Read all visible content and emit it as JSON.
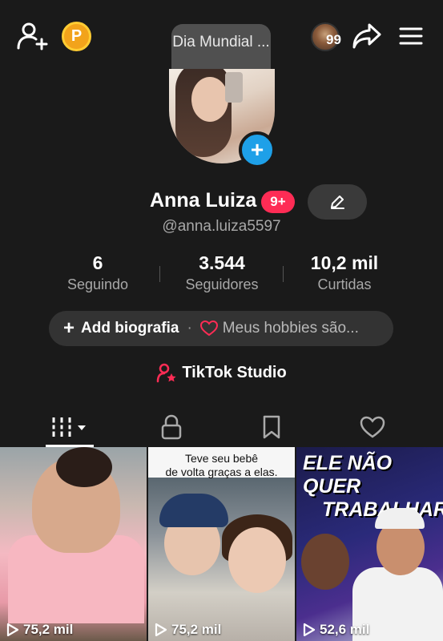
{
  "topbar": {
    "note_text": "Dia Mundial ...",
    "visitor_count": "99",
    "coin_letter": "P"
  },
  "profile": {
    "name": "Anna Luiza",
    "badge": "9+",
    "handle": "@anna.luiza5597"
  },
  "stats": [
    {
      "value": "6",
      "label": "Seguindo"
    },
    {
      "value": "3.544",
      "label": "Seguidores"
    },
    {
      "value": "10,2 mil",
      "label": "Curtidas"
    }
  ],
  "bio": {
    "add_label": "Add biografia",
    "hobbies_label": "Meus hobbies são..."
  },
  "studio": {
    "label": "TikTok Studio"
  },
  "videos": [
    {
      "views": "75,2 mil",
      "caption": ""
    },
    {
      "views": "75,2 mil",
      "caption_line1": "Teve seu bebê",
      "caption_line2": "de volta graças a elas."
    },
    {
      "views": "52,6 mil",
      "caption_line1": "ELE NÃO QUER",
      "caption_line2": "TRABALHAR"
    }
  ],
  "colors": {
    "background": "#1a1a1a",
    "badge_red": "#fe2c55",
    "plus_blue": "#1ea0e8",
    "coin_orange": "#f2a31b",
    "secondary_text": "#a8a8a8"
  }
}
